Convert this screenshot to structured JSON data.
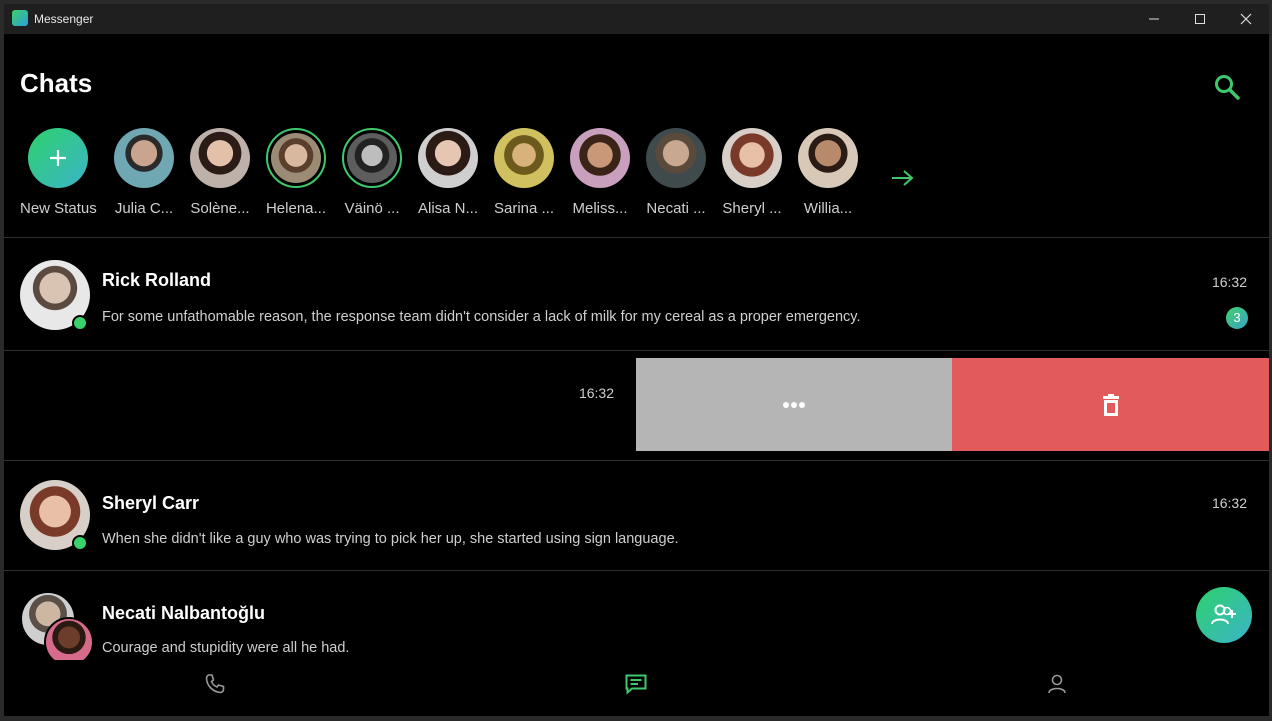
{
  "window": {
    "title": "Messenger",
    "controls": [
      "minimize-icon",
      "maximize-icon",
      "close-icon"
    ]
  },
  "header": {
    "title": "Chats",
    "search_icon": "search-icon"
  },
  "stories": [
    {
      "label": "New Status",
      "icon": "plus-icon"
    },
    {
      "label": "Julia C...",
      "ring": false,
      "color": "#6fa7b3"
    },
    {
      "label": "Solène...",
      "ring": false,
      "color": "#7e6a63"
    },
    {
      "label": "Helena...",
      "ring": true,
      "color": "#9b8b74"
    },
    {
      "label": "Väinö ...",
      "ring": true,
      "color": "#5d5d5d"
    },
    {
      "label": "Alisa N...",
      "ring": false,
      "color": "#8a6f63"
    },
    {
      "label": "Sarina ...",
      "ring": false,
      "color": "#b6a040"
    },
    {
      "label": "Meliss...",
      "ring": false,
      "color": "#b58aa6"
    },
    {
      "label": "Necati ...",
      "ring": false,
      "color": "#4f5a5c"
    },
    {
      "label": "Sheryl ...",
      "ring": false,
      "color": "#a0706a"
    },
    {
      "label": "Willia...",
      "ring": false,
      "color": "#b09a83"
    }
  ],
  "stories_more_icon": "arrow-right-icon",
  "chats": [
    {
      "name": "Rick Rolland",
      "message": "For some unfathomable reason, the response team didn't consider a lack of milk for my cereal as a proper emergency.",
      "time": "16:32",
      "unread": "3",
      "online": true
    },
    {
      "name": "",
      "message": "",
      "time": "16:32",
      "swiped": true,
      "actions": [
        "more-icon",
        "trash-icon"
      ]
    },
    {
      "name": "Sheryl Carr",
      "message": "When she didn't like a guy who was trying to pick her up, she started using sign language.",
      "time": "16:32",
      "online": true
    },
    {
      "name": "Necati Nalbantoğlu",
      "message": "Courage and stupidity were all he had.",
      "time": ""
    }
  ],
  "fab_icon": "add-group-icon",
  "bottom_nav": [
    {
      "icon": "phone-icon",
      "active": false
    },
    {
      "icon": "chat-icon",
      "active": true
    },
    {
      "icon": "person-icon",
      "active": false
    }
  ],
  "colors": {
    "accent": "#3ec86b",
    "delete": "#e35a5a",
    "more": "#b5b5b5",
    "background": "#000000"
  }
}
